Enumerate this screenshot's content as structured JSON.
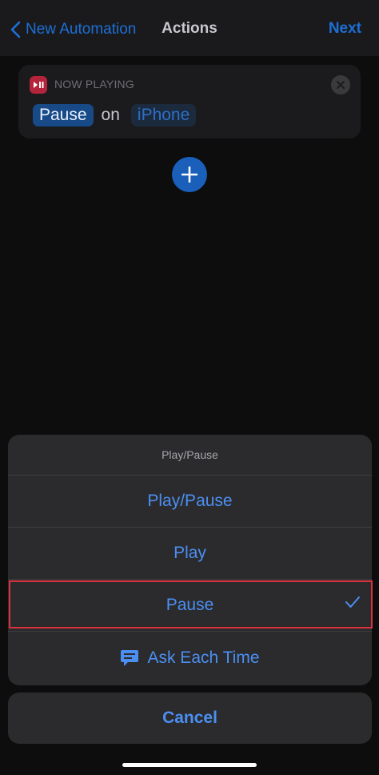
{
  "navbar": {
    "back_label": "New Automation",
    "title": "Actions",
    "next_label": "Next"
  },
  "action_card": {
    "app_name": "NOW PLAYING",
    "action_value": "Pause",
    "connector": "on",
    "device_value": "iPhone"
  },
  "sheet": {
    "title": "Play/Pause",
    "options": [
      {
        "label": "Play/Pause",
        "selected": false
      },
      {
        "label": "Play",
        "selected": false
      },
      {
        "label": "Pause",
        "selected": true
      },
      {
        "label": "Ask Each Time",
        "selected": false,
        "icon": "chat-bubble-icon"
      }
    ],
    "cancel_label": "Cancel"
  },
  "colors": {
    "accent": "#4b8ff2",
    "nav_accent": "#1d6fd6",
    "app_badge": "#b4243b",
    "highlight": "#d8323f"
  }
}
